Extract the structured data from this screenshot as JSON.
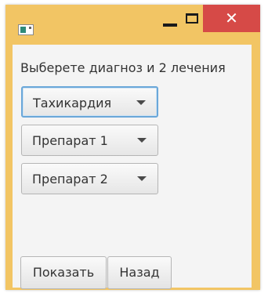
{
  "window": {
    "title": ""
  },
  "titlebar": {
    "minimize_icon": "minimize-icon",
    "maximize_icon": "maximize-icon",
    "close_glyph": "✕",
    "close_color": "#d64a47",
    "frame_color": "#f2c564"
  },
  "form": {
    "prompt": "Выберете диагноз и 2 лечения",
    "diagnosis": {
      "selected": "Тахикардия"
    },
    "treatment1": {
      "selected": "Препарат 1"
    },
    "treatment2": {
      "selected": "Препарат 2"
    },
    "show_label": "Показать",
    "back_label": "Назад"
  }
}
